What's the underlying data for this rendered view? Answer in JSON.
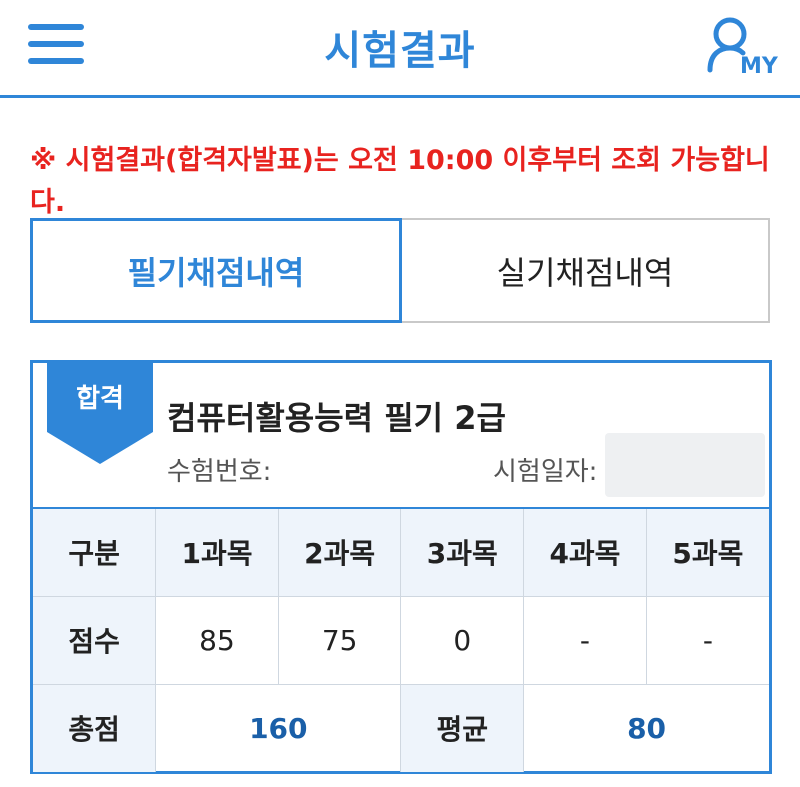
{
  "header": {
    "title": "시험결과",
    "my_label": "MY"
  },
  "notice": "※ 시험결과(합격자발표)는 오전 10:00 이후부터 조회 가능합니다.",
  "tabs": [
    {
      "label": "필기채점내역",
      "active": true
    },
    {
      "label": "실기채점내역",
      "active": false
    }
  ],
  "result": {
    "badge": "합격",
    "title": "컴퓨터활용능력 필기 2급",
    "exam_no_label": "수험번호:",
    "exam_date_label": "시험일자:",
    "table": {
      "header": [
        "구분",
        "1과목",
        "2과목",
        "3과목",
        "4과목",
        "5과목"
      ],
      "score_row": [
        "점수",
        "85",
        "75",
        "0",
        "-",
        "-"
      ],
      "total_label": "총점",
      "total_value": "160",
      "average_label": "평균",
      "average_value": "80"
    }
  },
  "colors": {
    "accent": "#2f86d8",
    "notice": "#e8231f",
    "value_blue": "#1a5fa8"
  }
}
